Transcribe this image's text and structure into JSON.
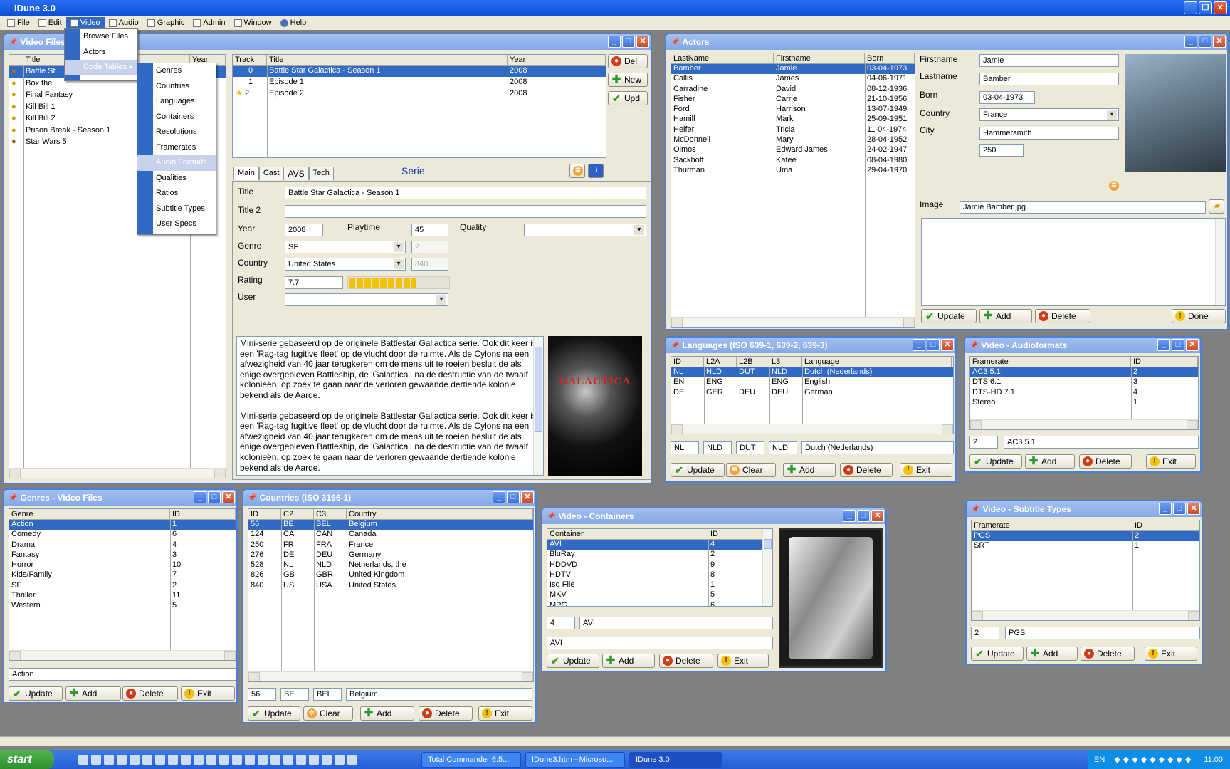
{
  "app": {
    "title": "IDune 3.0"
  },
  "menubar": [
    {
      "label": "File"
    },
    {
      "label": "Edit"
    },
    {
      "label": "Video"
    },
    {
      "label": "Audio"
    },
    {
      "label": "Graphic"
    },
    {
      "label": "Admin"
    },
    {
      "label": "Window"
    },
    {
      "label": "Help"
    }
  ],
  "video_menu": [
    "Browse Files",
    "Actors",
    "Code Tables"
  ],
  "codetables_menu": [
    "Genres",
    "Countries",
    "Languages",
    "Containers",
    "Resolutions",
    "Framerates",
    "Audio Formats",
    "Qualities",
    "Ratios",
    "Subtitle Types",
    "User Specs"
  ],
  "video_files": {
    "title": "Video Files",
    "cols": [
      "Title",
      "Year"
    ],
    "titles": [
      "Battle St",
      "Box the",
      "Final Fantasy",
      "Kill Bill 1",
      "Kill Bill 2",
      "Prison Break - Season 1",
      "Star Wars 5"
    ],
    "track_cols": [
      "Track",
      "Title",
      "Year"
    ],
    "tracks": [
      [
        "0",
        "Battle Star Galactica - Season 1",
        "2008"
      ],
      [
        "1",
        "Episode 1",
        "2008"
      ],
      [
        "2",
        "Episode 2",
        "2008"
      ]
    ],
    "btn_del": "Del",
    "btn_new": "New",
    "btn_upd": "Upd",
    "tabs": [
      "Main",
      "Cast",
      "AVS",
      "Tech"
    ],
    "type_label": "Serie",
    "lbl_title": "Title",
    "val_title": "Battle Star Galactica - Season 1",
    "lbl_title2": "Title 2",
    "val_title2": "",
    "lbl_year": "Year",
    "val_year": "2008",
    "lbl_playtime": "Playtime",
    "val_playtime": "45",
    "lbl_quality": "Quality",
    "val_quality": "",
    "lbl_genre": "Genre",
    "val_genre": "SF",
    "val_genre_id": "2",
    "lbl_country": "Country",
    "val_country": "United States",
    "val_country_id": "840",
    "lbl_rating": "Rating",
    "val_rating": "7.7",
    "lbl_user": "User",
    "val_user": "",
    "description_p1": "Mini-serie gebaseerd op de originele Battlestar Gallactica serie. Ook dit keer is een 'Rag-tag fugitive fleet' op de vlucht door de ruimte. Als de Cylons na een afwezigheid van 40 jaar terugkeren om de mens uit te roeien besluit de als enige overgebleven Battleship, de 'Galactica', na de destructie van de twaalf kolonieën, op zoek te gaan naar de verloren gewaande dertiende kolonie bekend als de Aarde.",
    "description_p2": "Mini-serie gebaseerd op de originele Battlestar Gallactica serie. Ook dit keer is een 'Rag-tag fugitive fleet' op de vlucht door de ruimte. Als de Cylons na een afwezigheid van 40 jaar terugkeren om de mens uit te roeien besluit de als enige overgebleven Battleship, de 'Galactica', na de destructie van de twaalf kolonieën, op zoek te gaan naar de verloren gewaande dertiende kolonie bekend als de Aarde.",
    "poster_text": "GALACTICA"
  },
  "actors": {
    "title": "Actors",
    "cols": [
      "LastName",
      "Firstname",
      "Born"
    ],
    "rows": [
      [
        "Bamber",
        "Jamie",
        "03-04-1973"
      ],
      [
        "Callis",
        "James",
        "04-06-1971"
      ],
      [
        "Carradine",
        "David",
        "08-12-1936"
      ],
      [
        "Fisher",
        "Carrie",
        "21-10-1956"
      ],
      [
        "Ford",
        "Harrison",
        "13-07-1949"
      ],
      [
        "Hamill",
        "Mark",
        "25-09-1951"
      ],
      [
        "Helfer",
        "Tricia",
        "11-04-1974"
      ],
      [
        "McDonnell",
        "Mary",
        "28-04-1952"
      ],
      [
        "Olmos",
        "Edward James",
        "24-02-1947"
      ],
      [
        "Sackhoff",
        "Katee",
        "08-04-1980"
      ],
      [
        "Thurman",
        "Uma",
        "29-04-1970"
      ]
    ],
    "lbl_firstname": "Firstname",
    "val_firstname": "Jamie",
    "lbl_lastname": "Lastname",
    "val_lastname": "Bamber",
    "lbl_born": "Born",
    "val_born": "03-04-1973",
    "lbl_country": "Country",
    "val_country": "France",
    "lbl_city": "City",
    "val_city": "Hammersmith",
    "val_city_id": "250",
    "lbl_image": "Image",
    "val_image": "Jamie Bamber.jpg",
    "btn_update": "Update",
    "btn_add": "Add",
    "btn_delete": "Delete",
    "btn_done": "Done"
  },
  "languages": {
    "title": "Languages (ISO 639-1, 639-2, 639-3)",
    "cols": [
      "ID",
      "L2A",
      "L2B",
      "L3",
      "Language"
    ],
    "rows": [
      [
        "NL",
        "NLD",
        "DUT",
        "NLD",
        "Dutch (Nederlands)"
      ],
      [
        "EN",
        "ENG",
        "",
        "ENG",
        "English"
      ],
      [
        "DE",
        "GER",
        "DEU",
        "DEU",
        "German"
      ]
    ],
    "edit": [
      "NL",
      "NLD",
      "DUT",
      "NLD",
      "Dutch (Nederlands)"
    ],
    "btn_update": "Update",
    "btn_clear": "Clear",
    "btn_add": "Add",
    "btn_delete": "Delete",
    "btn_exit": "Exit"
  },
  "audioformats": {
    "title": "Video - Audioformats",
    "cols": [
      "Framerate",
      "ID"
    ],
    "rows": [
      [
        "AC3 5.1",
        "2"
      ],
      [
        "DTS 6.1",
        "3"
      ],
      [
        "DTS-HD 7.1",
        "4"
      ],
      [
        "Stereo",
        "1"
      ]
    ],
    "edit": [
      "2",
      "AC3 5.1"
    ],
    "btn_update": "Update",
    "btn_add": "Add",
    "btn_delete": "Delete",
    "btn_exit": "Exit"
  },
  "genres": {
    "title": "Genres - Video Files",
    "cols": [
      "Genre",
      "ID"
    ],
    "rows": [
      [
        "Action",
        "1"
      ],
      [
        "Comedy",
        "6"
      ],
      [
        "Drama",
        "4"
      ],
      [
        "Fantasy",
        "3"
      ],
      [
        "Horror",
        "10"
      ],
      [
        "Kids/Family",
        "7"
      ],
      [
        "SF",
        "2"
      ],
      [
        "Thriller",
        "11"
      ],
      [
        "Western",
        "5"
      ]
    ],
    "edit": "Action",
    "btn_update": "Update",
    "btn_add": "Add",
    "btn_delete": "Delete",
    "btn_exit": "Exit"
  },
  "countries": {
    "title": "Countries (ISO 3166-1)",
    "cols": [
      "ID",
      "C2",
      "C3",
      "Country"
    ],
    "rows": [
      [
        "56",
        "BE",
        "BEL",
        "Belgium"
      ],
      [
        "124",
        "CA",
        "CAN",
        "Canada"
      ],
      [
        "250",
        "FR",
        "FRA",
        "France"
      ],
      [
        "276",
        "DE",
        "DEU",
        "Germany"
      ],
      [
        "528",
        "NL",
        "NLD",
        "Netherlands, the"
      ],
      [
        "826",
        "GB",
        "GBR",
        "United Kingdom"
      ],
      [
        "840",
        "US",
        "USA",
        "United States"
      ]
    ],
    "edit": [
      "56",
      "BE",
      "BEL",
      "Belgium"
    ],
    "btn_update": "Update",
    "btn_clear": "Clear",
    "btn_add": "Add",
    "btn_delete": "Delete",
    "btn_exit": "Exit"
  },
  "containers": {
    "title": "Video - Containers",
    "cols": [
      "Container",
      "ID"
    ],
    "rows": [
      [
        "AVI",
        "4"
      ],
      [
        "BluRay",
        "2"
      ],
      [
        "HDDVD",
        "9"
      ],
      [
        "HDTV",
        "8"
      ],
      [
        "Iso File",
        "1"
      ],
      [
        "MKV",
        "5"
      ],
      [
        "MPG",
        "6"
      ]
    ],
    "edit": [
      "4",
      "AVI"
    ],
    "edit2": "AVI",
    "btn_update": "Update",
    "btn_add": "Add",
    "btn_delete": "Delete",
    "btn_exit": "Exit"
  },
  "subtitles": {
    "title": "Video - Subtitle Types",
    "cols": [
      "Framerate",
      "ID"
    ],
    "rows": [
      [
        "PGS",
        "2"
      ],
      [
        "SRT",
        "1"
      ]
    ],
    "edit": [
      "2",
      "PGS"
    ],
    "btn_update": "Update",
    "btn_add": "Add",
    "btn_delete": "Delete",
    "btn_exit": "Exit"
  },
  "taskbar": {
    "start": "start",
    "tasks": [
      "Total Commander 6.5...",
      "IDune3.htm - Microso...",
      "IDune 3.0"
    ],
    "lang": "EN",
    "clock": "11:00"
  },
  "colors": {
    "selection": "#316ac5",
    "titlebar": "#84a9e6",
    "window_bg": "#ece9d8",
    "desktop": "#808080"
  }
}
